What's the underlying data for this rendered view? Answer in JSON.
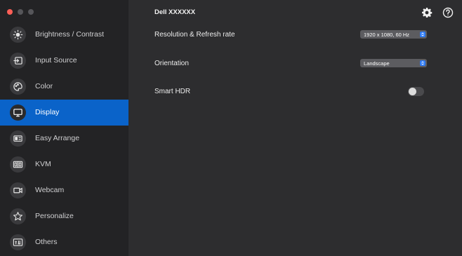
{
  "window": {
    "title": "Dell XXXXXX"
  },
  "colors": {
    "accent": "#0a63c9",
    "sidebar_bg": "#232325",
    "main_bg": "#2d2d2f",
    "close": "#fe5f57"
  },
  "sidebar": {
    "items": [
      {
        "label": "Brightness / Contrast",
        "icon": "sun-icon",
        "active": false
      },
      {
        "label": "Input Source",
        "icon": "input-source-icon",
        "active": false
      },
      {
        "label": "Color",
        "icon": "palette-icon",
        "active": false
      },
      {
        "label": "Display",
        "icon": "monitor-icon",
        "active": true
      },
      {
        "label": "Easy Arrange",
        "icon": "easy-arrange-icon",
        "active": false
      },
      {
        "label": "KVM",
        "icon": "kvm-icon",
        "active": false
      },
      {
        "label": "Webcam",
        "icon": "webcam-icon",
        "active": false
      },
      {
        "label": "Personalize",
        "icon": "star-icon",
        "active": false
      },
      {
        "label": "Others",
        "icon": "others-icon",
        "active": false
      }
    ]
  },
  "header": {
    "settings_icon": "gear-icon",
    "help_icon": "help-icon"
  },
  "display": {
    "resolution": {
      "label": "Resolution & Refresh rate",
      "value": "1920 x 1080, 60 Hz"
    },
    "orientation": {
      "label": "Orientation",
      "value": "Landscape"
    },
    "smart_hdr": {
      "label": "Smart HDR",
      "enabled": false
    }
  }
}
